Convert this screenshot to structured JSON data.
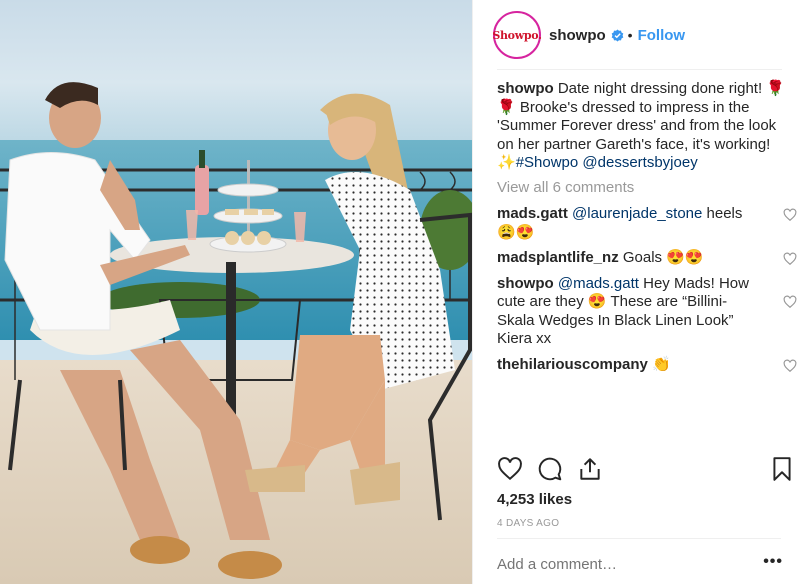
{
  "header": {
    "avatar_text": "Showpo.",
    "username": "showpo",
    "separator": "•",
    "follow_label": "Follow"
  },
  "caption": {
    "username": "showpo",
    "text": " Date night dressing done right! 🌹 🌹 Brooke's dressed to impress in the 'Summer Forever dress' and from the look on her partner Gareth's face, it's working! ✨",
    "hashtag": "#Showpo",
    "mention": "@dessertsbyjoey"
  },
  "view_all_comments": "View all 6 comments",
  "comments": [
    {
      "username": "mads.gatt",
      "mention": "@laurenjade_stone",
      "text": " heels 😩😍"
    },
    {
      "username": "madsplantlife_nz",
      "mention": "",
      "text": " Goals 😍😍"
    },
    {
      "username": "showpo",
      "mention": "@mads.gatt",
      "text": " Hey Mads! How cute are they 😍 These are “Billini-Skala Wedges In Black Linen Look” Kiera xx"
    },
    {
      "username": "thehilariouscompany",
      "mention": "",
      "text": " 👏"
    }
  ],
  "likes": "4,253 likes",
  "age": "4 DAYS AGO",
  "add_comment_placeholder": "Add a comment…",
  "more_label": "•••",
  "colors": {
    "accent": "#3897f0",
    "mention": "#003569",
    "muted": "#999999",
    "text": "#262626"
  },
  "icons": [
    "verified-badge-icon",
    "heart-icon",
    "comment-icon",
    "share-icon",
    "bookmark-icon",
    "small-heart-icon"
  ]
}
